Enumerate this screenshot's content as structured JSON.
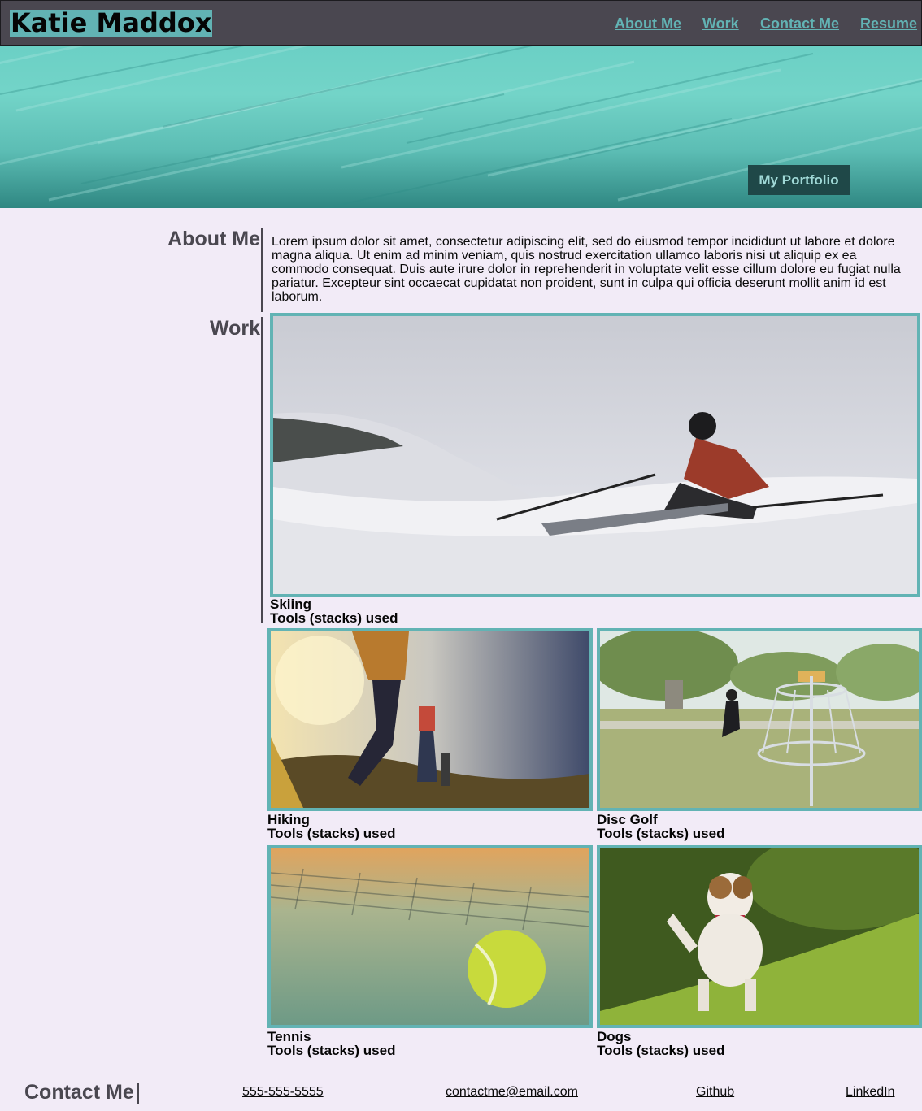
{
  "header": {
    "brand": "Katie Maddox",
    "nav": [
      "About Me",
      "Work",
      "Contact Me",
      "Resume"
    ]
  },
  "hero": {
    "button": "My Portfolio"
  },
  "about": {
    "title": "About Me",
    "text": "Lorem ipsum dolor sit amet, consectetur adipiscing elit, sed do eiusmod tempor incididunt ut labore et dolore magna aliqua. Ut enim ad minim veniam, quis nostrud exercitation ullamco laboris nisi ut aliquip ex ea commodo consequat. Duis aute irure dolor in reprehenderit in voluptate velit esse cillum dolore eu fugiat nulla pariatur. Excepteur sint occaecat cupidatat non proident, sunt in culpa qui officia deserunt mollit anim id est laborum."
  },
  "work": {
    "title": "Work",
    "projects": [
      {
        "name": "Skiing",
        "tools": "Tools (stacks) used"
      },
      {
        "name": "Hiking",
        "tools": "Tools (stacks) used"
      },
      {
        "name": "Disc Golf",
        "tools": "Tools (stacks) used"
      },
      {
        "name": "Tennis",
        "tools": "Tools (stacks) used"
      },
      {
        "name": "Dogs",
        "tools": "Tools (stacks) used"
      }
    ]
  },
  "contact": {
    "title": "Contact Me",
    "phone": "555-555-5555",
    "email": "contactme@email.com",
    "github": "Github",
    "linkedin": "LinkedIn"
  },
  "colors": {
    "accent": "#62b3b4",
    "header_bg": "#4a4750",
    "page_bg": "#f2ebf7",
    "button_bg": "#1f4848"
  }
}
